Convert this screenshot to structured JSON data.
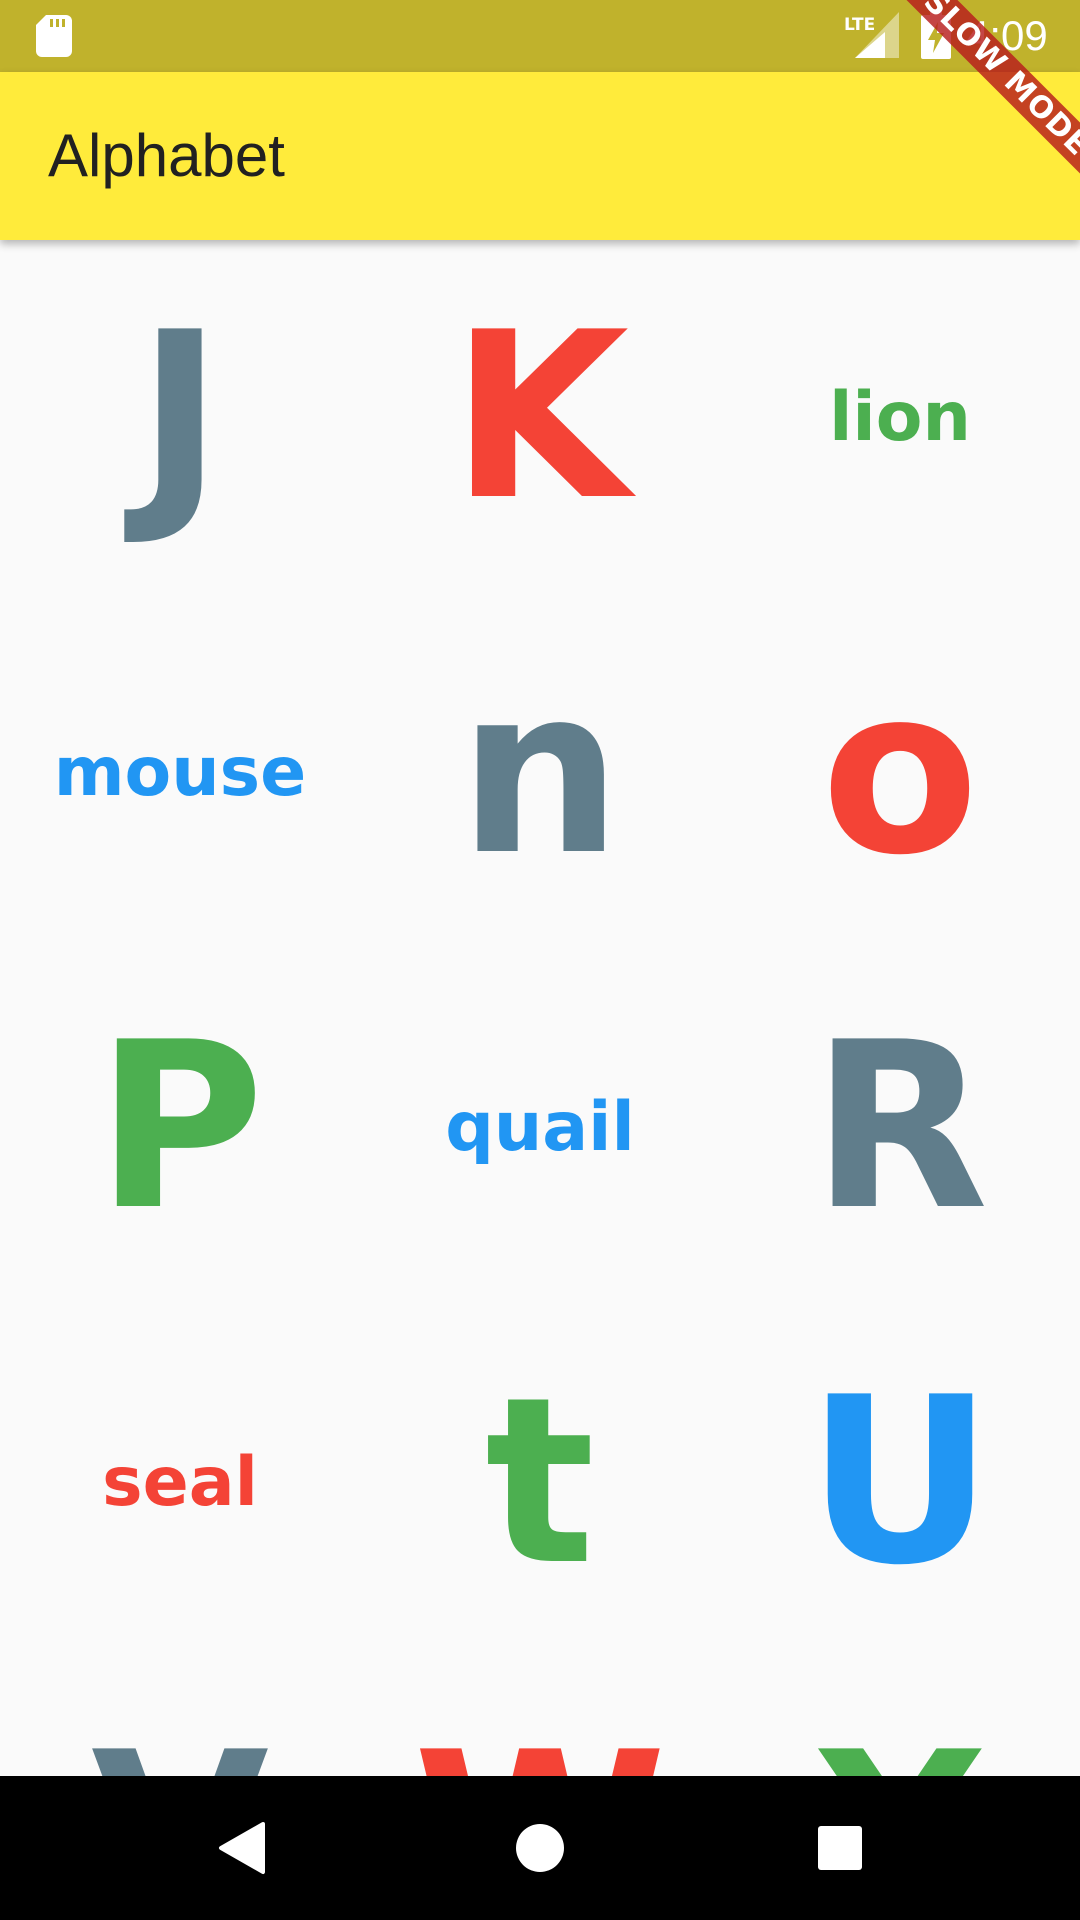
{
  "status_bar": {
    "time": "4:09",
    "network_label": "LTE",
    "background_color": "#c0b22c",
    "icons": [
      "sd-card-icon",
      "lte-signal-icon",
      "battery-charging-icon"
    ]
  },
  "app_bar": {
    "title": "Alphabet",
    "background_color": "#ffeb3b"
  },
  "debug_banner": {
    "label": "SLOW MODE"
  },
  "colors": {
    "grey": "#607d8b",
    "red": "#f44336",
    "green": "#4caf50",
    "blue": "#2196f3"
  },
  "grid": {
    "columns": 3,
    "tiles": [
      {
        "text": "J",
        "kind": "letter",
        "color": "#607d8b"
      },
      {
        "text": "K",
        "kind": "letter",
        "color": "#f44336"
      },
      {
        "text": "lion",
        "kind": "word",
        "color": "#4caf50"
      },
      {
        "text": "mouse",
        "kind": "word",
        "color": "#2196f3"
      },
      {
        "text": "n",
        "kind": "letter",
        "color": "#607d8b"
      },
      {
        "text": "o",
        "kind": "letter",
        "color": "#f44336"
      },
      {
        "text": "P",
        "kind": "letter",
        "color": "#4caf50"
      },
      {
        "text": "quail",
        "kind": "word",
        "color": "#2196f3"
      },
      {
        "text": "R",
        "kind": "letter",
        "color": "#607d8b"
      },
      {
        "text": "seal",
        "kind": "word",
        "color": "#f44336"
      },
      {
        "text": "t",
        "kind": "letter",
        "color": "#4caf50"
      },
      {
        "text": "U",
        "kind": "letter",
        "color": "#2196f3"
      },
      {
        "text": "V",
        "kind": "letter",
        "color": "#607d8b"
      },
      {
        "text": "W",
        "kind": "letter",
        "color": "#f44336"
      },
      {
        "text": "X",
        "kind": "letter",
        "color": "#4caf50"
      }
    ]
  },
  "nav_bar": {
    "buttons": [
      "back-icon",
      "home-icon",
      "recents-icon"
    ]
  }
}
